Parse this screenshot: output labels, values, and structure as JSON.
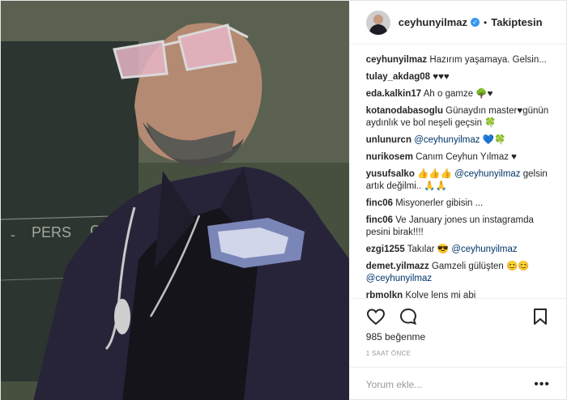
{
  "post": {
    "username": "ceyhunyilmaz",
    "verified_icon": "verified-badge-icon",
    "separator": "•",
    "follow_status": "Takiptesin"
  },
  "comments": [
    {
      "user": "ceyhunyilmaz",
      "text": "Hazırım yaşamaya. Gelsin..."
    },
    {
      "user": "tulay_akdag08",
      "text": "♥♥♥"
    },
    {
      "user": "eda.kalkin17",
      "text": "Ah o gamze 🌳♥"
    },
    {
      "user": "kotanodabasoglu",
      "text": "Günaydın master♥günün aydınlık ve bol neşeli geçsin 🍀"
    },
    {
      "user": "unlunurcn",
      "mention": "@ceyhunyilmaz",
      "text": "💙🍀"
    },
    {
      "user": "nurikosem",
      "text": "Canım Ceyhun Yılmaz ♥"
    },
    {
      "user": "yusufsalko",
      "text_before": "👍👍👍",
      "mention": "@ceyhunyilmaz",
      "text": "gelsin artık değilmi.. 🙏🙏"
    },
    {
      "user": "finc06",
      "text": "Misyonerler gibisin ..."
    },
    {
      "user": "finc06",
      "text": "Ve January jones un instagramda pesini birak!!!!"
    },
    {
      "user": "ezgi1255",
      "text_before": "Takılar 😎",
      "mention": "@ceyhunyilmaz",
      "text": ""
    },
    {
      "user": "demet.yilmazz",
      "text_before": "Gamzeli gülüşten 😊😊",
      "mention": "@ceyhunyilmaz",
      "text": ""
    },
    {
      "user": "rbmolkn",
      "text": "Kolye lens mi abi"
    }
  ],
  "actions": {
    "like_icon": "heart-icon",
    "comment_icon": "comment-icon",
    "save_icon": "bookmark-icon",
    "likes": "985 beğenme",
    "timestamp": "1 SAAT ÖNCE"
  },
  "add_comment": {
    "placeholder": "Yorum ekle...",
    "more": "•••"
  },
  "colors": {
    "link": "#003569",
    "verified": "#3897f0",
    "border": "#efefef",
    "muted": "#999999"
  }
}
